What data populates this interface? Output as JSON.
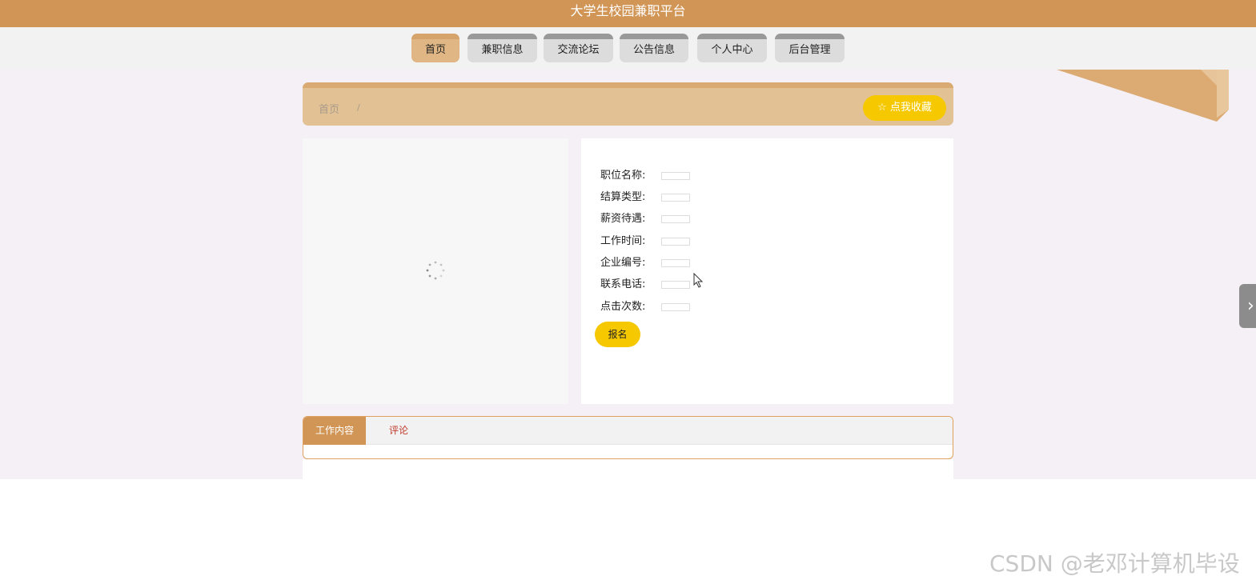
{
  "header": {
    "title": "大学生校园兼职平台"
  },
  "nav": {
    "items": [
      {
        "label": "首页"
      },
      {
        "label": "兼职信息"
      },
      {
        "label": "交流论坛"
      },
      {
        "label": "公告信息"
      },
      {
        "label": "个人中心"
      },
      {
        "label": "后台管理"
      }
    ]
  },
  "breadcrumb": {
    "home": "首页",
    "separator": "/"
  },
  "favorite": {
    "label": "☆ 点我收藏"
  },
  "details": {
    "fields": [
      {
        "label": "职位名称:",
        "value": ""
      },
      {
        "label": "结算类型:",
        "value": ""
      },
      {
        "label": "薪资待遇:",
        "value": ""
      },
      {
        "label": "工作时间:",
        "value": ""
      },
      {
        "label": "企业编号:",
        "value": ""
      },
      {
        "label": "联系电话:",
        "value": ""
      },
      {
        "label": "点击次数:",
        "value": ""
      }
    ],
    "signup_label": "报名"
  },
  "tabs": {
    "items": [
      {
        "label": "工作内容"
      },
      {
        "label": "评论"
      }
    ]
  },
  "side": {
    "arrow": "›"
  },
  "watermark": "CSDN @老邓计算机毕设",
  "colors": {
    "primary": "#d19556",
    "accent": "#f5c800",
    "crumb_bg": "#e2c295"
  }
}
